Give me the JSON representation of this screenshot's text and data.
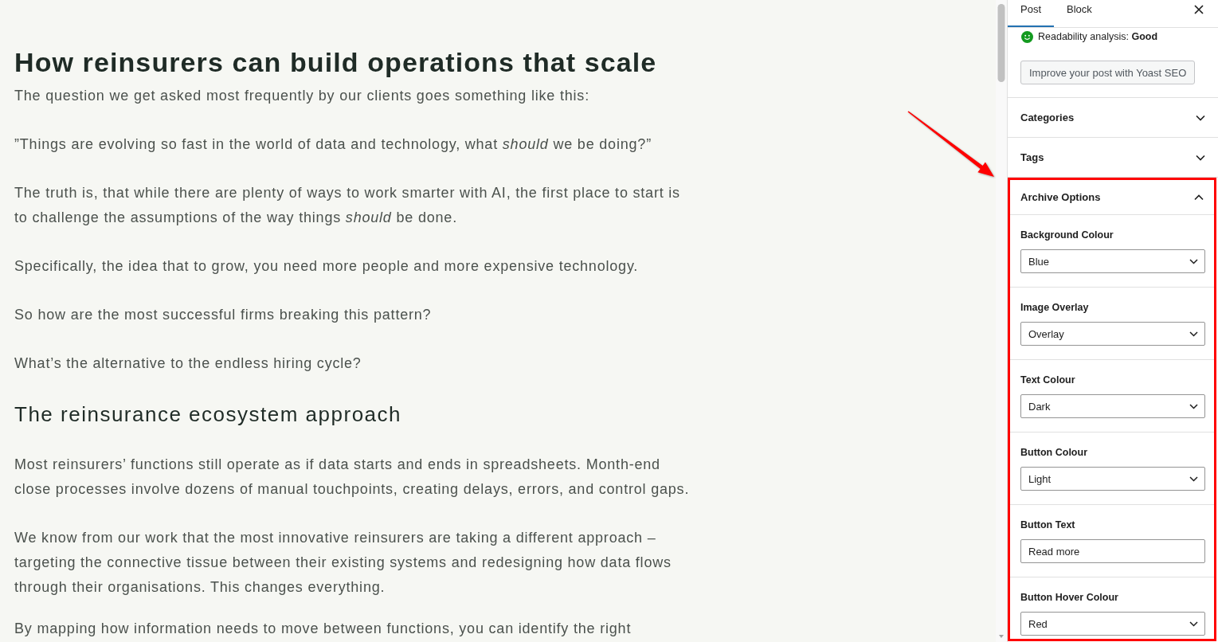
{
  "editor": {
    "title": "How reinsurers can build operations that scale",
    "blocks": [
      {
        "kind": "paragraph",
        "text": "The question we get asked most frequently by our clients goes something like this:"
      },
      {
        "kind": "paragraph",
        "text": "”Things are evolving so fast in the world of data and technology, what *should* we be doing?”"
      },
      {
        "kind": "paragraph",
        "text": "The truth is, that while there are plenty of ways to work smarter with AI, the first place to start is to challenge the assumptions of the way things *should* be done."
      },
      {
        "kind": "paragraph",
        "text": "Specifically, the idea that to grow, you need more people and more expensive technology."
      },
      {
        "kind": "paragraph",
        "text": "So how are the most successful firms breaking this pattern?"
      },
      {
        "kind": "paragraph",
        "text": "What’s the alternative to the endless hiring cycle?"
      },
      {
        "kind": "heading",
        "text": "The reinsurance ecosystem approach"
      },
      {
        "kind": "paragraph",
        "text": "Most reinsurers’ functions still operate as if data starts and ends in spreadsheets. Month-end close processes involve dozens of manual touchpoints, creating delays, errors, and control gaps."
      },
      {
        "kind": "paragraph",
        "text": "We know from our work that the most innovative reinsurers are taking a different approach – targeting the connective tissue between their existing systems and redesigning how data flows through their organisations. This changes everything."
      },
      {
        "kind": "paragraph",
        "text": "By mapping how information needs to move between functions, you can identify the right"
      }
    ]
  },
  "sidebar": {
    "tabs": [
      {
        "label": "Post",
        "selected": true
      },
      {
        "label": "Block",
        "selected": false
      }
    ],
    "readability": "Readability analysis: **Good**",
    "yoast_button": "Improve your post with Yoast SEO",
    "panels": [
      {
        "title": "Categories",
        "expanded": false,
        "highlighted": false
      },
      {
        "title": "Tags",
        "expanded": false,
        "highlighted": false
      },
      {
        "title": "Archive Options",
        "expanded": true,
        "highlighted": true,
        "fields": [
          {
            "kind": "select",
            "label": "Background Colour",
            "value": "Blue"
          },
          {
            "kind": "select",
            "label": "Image Overlay",
            "value": "Overlay"
          },
          {
            "kind": "select",
            "label": "Text Colour",
            "value": "Dark"
          },
          {
            "kind": "select",
            "label": "Button Colour",
            "value": "Light"
          },
          {
            "kind": "text",
            "label": "Button Text",
            "value": "Read more"
          },
          {
            "kind": "select",
            "label": "Button Hover Colour",
            "value": "Red"
          }
        ]
      }
    ]
  }
}
